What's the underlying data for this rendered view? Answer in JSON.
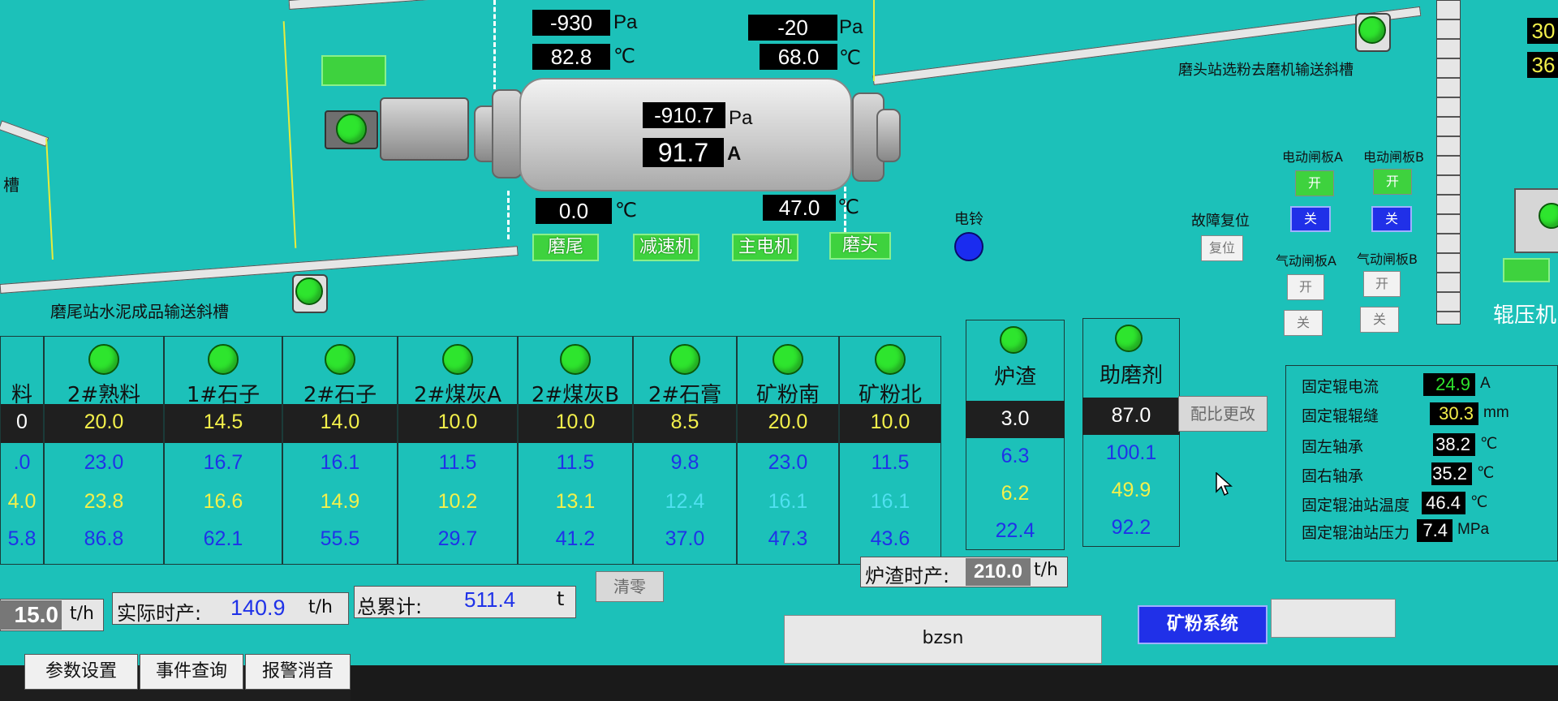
{
  "top": {
    "left_pressure": "-930",
    "left_temp": "82.8",
    "right_pressure": "-20",
    "right_temp": "68.0",
    "mill_pressure": "-910.7",
    "mill_current": "91.7",
    "bottom_left_temp": "0.0",
    "bottom_right_temp": "47.0",
    "unit_pa": "Pa",
    "unit_c": "℃",
    "unit_a": "A"
  },
  "labels": {
    "tail_conveyor": "磨尾站水泥成品输送斜槽",
    "head_conveyor": "磨头站选粉去磨机输送斜槽",
    "left_cut": "槽",
    "bell": "电铃",
    "fault_reset": "故障复位",
    "reset_btn": "复位",
    "roller_press": "辊压机"
  },
  "equipment_buttons": [
    "磨尾",
    "减速机",
    "主电机",
    "磨头"
  ],
  "gates": {
    "elec_a": "电动闸板A",
    "elec_b": "电动闸板B",
    "air_a": "气动闸板A",
    "air_b": "气动闸板B",
    "open": "开",
    "close": "关"
  },
  "materials": {
    "headers": [
      "料",
      "2#熟料",
      "1#石子",
      "2#石子",
      "2#煤灰A",
      "2#煤灰B",
      "2#石膏",
      "矿粉南",
      "矿粉北"
    ],
    "row1": [
      "0",
      "20.0",
      "14.5",
      "14.0",
      "10.0",
      "10.0",
      "8.5",
      "20.0",
      "10.0"
    ],
    "row2": [
      ".0",
      "23.0",
      "16.7",
      "16.1",
      "11.5",
      "11.5",
      "9.8",
      "23.0",
      "11.5"
    ],
    "row3": [
      "4.0",
      "23.8",
      "16.6",
      "14.9",
      "10.2",
      "13.1",
      "12.4",
      "16.1",
      "16.1"
    ],
    "row4": [
      "5.8",
      "86.8",
      "62.1",
      "55.5",
      "29.7",
      "41.2",
      "37.0",
      "47.3",
      "43.6"
    ]
  },
  "slag": {
    "header": "炉渣",
    "values": [
      "3.0",
      "6.3",
      "6.2",
      "22.4"
    ]
  },
  "aid": {
    "header": "助磨剂",
    "values": [
      "87.0",
      "100.1",
      "49.9",
      "92.2"
    ]
  },
  "ratio_change": "配比更改",
  "summary": {
    "left_value": "15.0",
    "left_unit": "t/h",
    "actual_label": "实际时产:",
    "actual_value": "140.9",
    "actual_unit": "t/h",
    "total_label": "总累计:",
    "total_value": "511.4",
    "total_unit": "t",
    "clear": "清零",
    "slag_label": "炉渣时产:",
    "slag_value": "210.0",
    "slag_unit": "t/h"
  },
  "roller": {
    "rows": [
      {
        "label": "固定辊电流",
        "value": "24.9",
        "unit": "A"
      },
      {
        "label": "固定辊辊缝",
        "value": "30.3",
        "unit": "mm"
      },
      {
        "label": "固左轴承",
        "value": "38.2",
        "unit": "℃"
      },
      {
        "label": "固右轴承",
        "value": "35.2",
        "unit": "℃"
      },
      {
        "label": "固定辊油站温度",
        "value": "46.4",
        "unit": "℃"
      },
      {
        "label": "固定辊油站压力",
        "value": "7.4",
        "unit": "MPa"
      }
    ],
    "edge_vals": [
      "30",
      "36"
    ]
  },
  "status": {
    "user": "bzsn",
    "system_btn": "矿粉系统"
  },
  "tabs": [
    "参数设置",
    "事件查询",
    "报警消音"
  ],
  "colors": {
    "background": "#1cc1b9",
    "run_green": "#2ee52e",
    "yellow_text": "#f3f04b",
    "blue_text": "#1f32e8"
  }
}
